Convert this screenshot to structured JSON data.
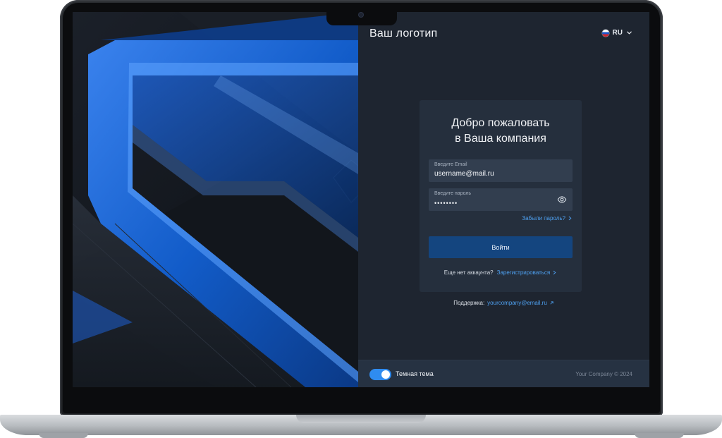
{
  "header": {
    "logo_text": "Ваш логотип",
    "language": {
      "code": "RU",
      "flag_icon": "russia-flag-icon",
      "chevron_icon": "chevron-down-icon"
    }
  },
  "login_card": {
    "title_line1": "Добро пожаловать",
    "title_line2": "в Ваша компания",
    "email_field": {
      "label": "Введите Email",
      "value": "username@mail.ru"
    },
    "password_field": {
      "label": "Введите пароль",
      "value": "••••••••",
      "toggle_icon": "eye-icon"
    },
    "forgot_password": "Забыли пароль?",
    "login_button": "Войти",
    "register_prompt": "Еще нет аккаунта?",
    "register_link": "Зарегистрироваться"
  },
  "support": {
    "label": "Поддержка:",
    "email": "yourcompany@email.ru"
  },
  "footer": {
    "dark_theme_label": "Темная тема",
    "dark_theme_enabled": true,
    "copyright": "Your Company © 2024"
  },
  "colors": {
    "accent": "#2f8cf0",
    "link": "#4ea0f0",
    "button": "#14457f",
    "panel_bg": "#1e2530",
    "card_bg": "#252f3d",
    "input_bg": "#323e4f"
  }
}
